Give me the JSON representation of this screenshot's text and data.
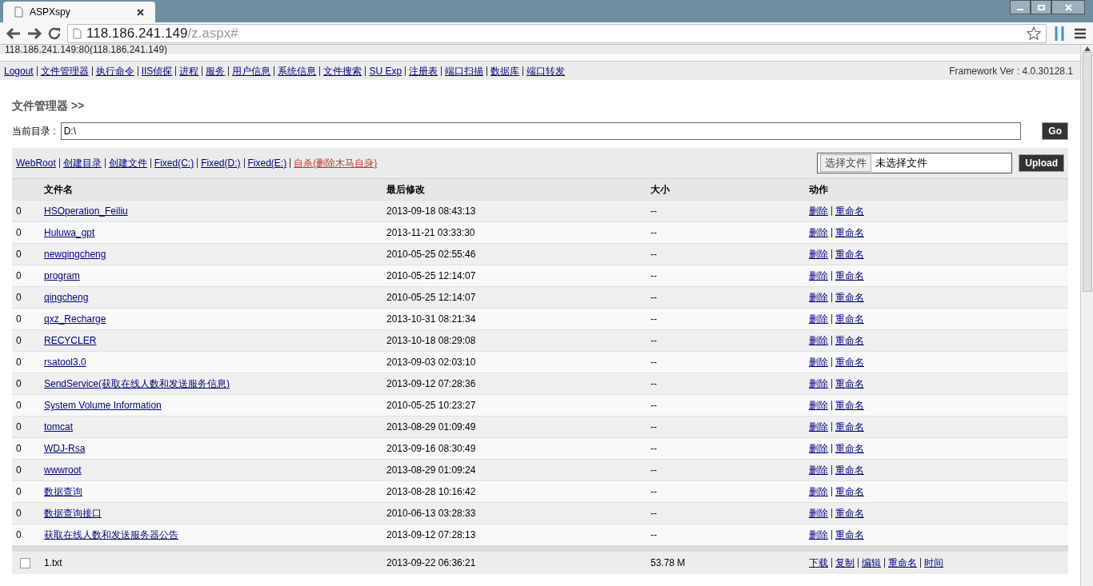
{
  "browser": {
    "tab_title": "ASPXspy",
    "url_host": "118.186.241.149",
    "url_path": "/z.aspx#"
  },
  "server_line": "118.186.241.149:80(118.186.241.149)",
  "nav": [
    "Logout",
    "文件管理器",
    "执行命令",
    "IIS侦探",
    "进程",
    "服务",
    "用户信息",
    "系统信息",
    "文件搜索",
    "SU Exp",
    "注册表",
    "端口扫描",
    "数据库",
    "端口转发"
  ],
  "framework": "Framework Ver : 4.0.30128.1",
  "title": "文件管理器 >>",
  "dir_label": "当前目录 :",
  "dir_value": "D:\\",
  "go_button": "Go",
  "links": [
    {
      "text": "WebRoot",
      "kind": "normal"
    },
    {
      "text": "创建目录",
      "kind": "normal"
    },
    {
      "text": "创建文件",
      "kind": "normal"
    },
    {
      "text": "Fixed(C:)",
      "kind": "normal"
    },
    {
      "text": "Fixed(D:)",
      "kind": "normal"
    },
    {
      "text": "Fixed(E:)",
      "kind": "normal"
    },
    {
      "text": "自杀(删除木马自身)",
      "kind": "danger"
    }
  ],
  "upload": {
    "choose_button": "选择文件",
    "file_status": "未选择文件",
    "button": "Upload"
  },
  "table": {
    "columns": [
      "文件名",
      "最后修改",
      "大小",
      "动作"
    ],
    "rows": [
      {
        "col": "0",
        "name": "HSOperation_Feiliu",
        "modified": "2013-09-18 08:43:13",
        "size": "--",
        "actions": [
          "删除",
          "重命名"
        ]
      },
      {
        "col": "0",
        "name": "Huluwa_gpt",
        "modified": "2013-11-21 03:33:30",
        "size": "--",
        "actions": [
          "删除",
          "重命名"
        ]
      },
      {
        "col": "0",
        "name": "newqingcheng",
        "modified": "2010-05-25 02:55:46",
        "size": "--",
        "actions": [
          "删除",
          "重命名"
        ]
      },
      {
        "col": "0",
        "name": "program",
        "modified": "2010-05-25 12:14:07",
        "size": "--",
        "actions": [
          "删除",
          "重命名"
        ]
      },
      {
        "col": "0",
        "name": "qingcheng",
        "modified": "2010-05-25 12:14:07",
        "size": "--",
        "actions": [
          "删除",
          "重命名"
        ]
      },
      {
        "col": "0",
        "name": "qxz_Recharge",
        "modified": "2013-10-31 08:21:34",
        "size": "--",
        "actions": [
          "删除",
          "重命名"
        ]
      },
      {
        "col": "0",
        "name": "RECYCLER",
        "modified": "2013-10-18 08:29:08",
        "size": "--",
        "actions": [
          "删除",
          "重命名"
        ]
      },
      {
        "col": "0",
        "name": "rsatool3.0",
        "modified": "2013-09-03 02:03:10",
        "size": "--",
        "actions": [
          "删除",
          "重命名"
        ]
      },
      {
        "col": "0",
        "name": "SendService(获取在线人数和发送服务信息)",
        "modified": "2013-09-12 07:28:36",
        "size": "--",
        "actions": [
          "删除",
          "重命名"
        ]
      },
      {
        "col": "0",
        "name": "System Volume Information",
        "modified": "2010-05-25 10:23:27",
        "size": "--",
        "actions": [
          "删除",
          "重命名"
        ]
      },
      {
        "col": "0",
        "name": "tomcat",
        "modified": "2013-08-29 01:09:49",
        "size": "--",
        "actions": [
          "删除",
          "重命名"
        ]
      },
      {
        "col": "0",
        "name": "WDJ-Rsa",
        "modified": "2013-09-16 08:30:49",
        "size": "--",
        "actions": [
          "删除",
          "重命名"
        ]
      },
      {
        "col": "0",
        "name": "wwwroot",
        "modified": "2013-08-29 01:09:24",
        "size": "--",
        "actions": [
          "删除",
          "重命名"
        ]
      },
      {
        "col": "0",
        "name": "数据查询",
        "modified": "2013-08-28 10:16:42",
        "size": "--",
        "actions": [
          "删除",
          "重命名"
        ]
      },
      {
        "col": "0",
        "name": "数据查询接口",
        "modified": "2010-06-13 03:28:33",
        "size": "--",
        "actions": [
          "删除",
          "重命名"
        ]
      },
      {
        "col": "0",
        "name": "获取在线人数和发送服务器公告",
        "modified": "2013-09-12 07:28:13",
        "size": "--",
        "actions": [
          "删除",
          "重命名"
        ]
      }
    ],
    "files": [
      {
        "checked": false,
        "name": "1.txt",
        "modified": "2013-09-22 06:36:21",
        "size": "53.78 M",
        "actions": [
          "下载",
          "复制",
          "编辑",
          "重命名",
          "时间"
        ]
      }
    ]
  }
}
